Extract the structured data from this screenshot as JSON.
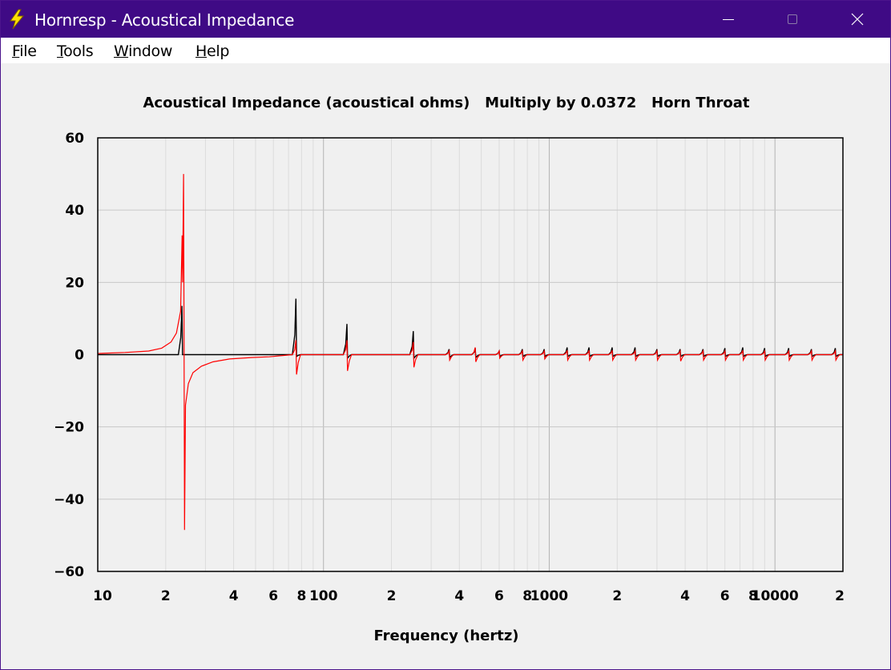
{
  "window": {
    "title": "Hornresp - Acoustical Impedance",
    "controls": [
      "minimize",
      "maximize",
      "close"
    ],
    "icon": "lightning-bolt-icon"
  },
  "menu": [
    {
      "label": "File",
      "accel": "F"
    },
    {
      "label": "Tools",
      "accel": "T"
    },
    {
      "label": "Window",
      "accel": "W"
    },
    {
      "label": "Help",
      "accel": "H"
    }
  ],
  "colors": {
    "titlebar": "#3f0a85",
    "series_black": "#000000",
    "series_red": "#ff0000",
    "grid": "#c8c8c8"
  },
  "chart_data": {
    "type": "line",
    "title": "Acoustical Impedance (acoustical ohms)   Multiply by 0.0372   Horn Throat",
    "xlabel": "Frequency (hertz)",
    "ylabel": "",
    "x_scale": "log",
    "xlim": [
      10,
      20000
    ],
    "ylim": [
      -60,
      60
    ],
    "yticks": [
      60,
      40,
      20,
      0,
      -20,
      -40,
      -60
    ],
    "ytick_labels": [
      "60",
      "40",
      "20",
      "0",
      "−20",
      "−40",
      "−60"
    ],
    "xticks": [
      {
        "value": 10,
        "label": "10"
      },
      {
        "value": 20,
        "label": "2"
      },
      {
        "value": 40,
        "label": "4"
      },
      {
        "value": 60,
        "label": "6"
      },
      {
        "value": 80,
        "label": "8"
      },
      {
        "value": 100,
        "label": "100"
      },
      {
        "value": 200,
        "label": "2"
      },
      {
        "value": 400,
        "label": "4"
      },
      {
        "value": 600,
        "label": "6"
      },
      {
        "value": 800,
        "label": "8"
      },
      {
        "value": 1000,
        "label": "1000"
      },
      {
        "value": 2000,
        "label": "2"
      },
      {
        "value": 4000,
        "label": "4"
      },
      {
        "value": 6000,
        "label": "6"
      },
      {
        "value": 8000,
        "label": "8"
      },
      {
        "value": 10000,
        "label": "10000"
      },
      {
        "value": 20000,
        "label": "2"
      }
    ],
    "grid": true,
    "series": [
      {
        "color": "#000000",
        "resonances": [
          {
            "f": 23.6,
            "pos": 13.5,
            "neg": 0
          },
          {
            "f": 75.5,
            "pos": 15.5,
            "neg": -0.5
          },
          {
            "f": 127,
            "pos": 8.5,
            "neg": -1
          },
          {
            "f": 250,
            "pos": 6.5,
            "neg": -1
          },
          {
            "f": 360,
            "pos": 1.5,
            "neg": -0.8
          },
          {
            "f": 470,
            "pos": 1.8,
            "neg": -0.8
          },
          {
            "f": 600,
            "pos": 1.0,
            "neg": -0.5
          },
          {
            "f": 760,
            "pos": 1.5,
            "neg": -0.5
          },
          {
            "f": 950,
            "pos": 1.5,
            "neg": -0.5
          },
          {
            "f": 1200,
            "pos": 2.0,
            "neg": -0.5
          },
          {
            "f": 1500,
            "pos": 2.0,
            "neg": -0.5
          },
          {
            "f": 1900,
            "pos": 2.0,
            "neg": -0.5
          },
          {
            "f": 2400,
            "pos": 2.0,
            "neg": -0.5
          },
          {
            "f": 3000,
            "pos": 1.5,
            "neg": -0.5
          },
          {
            "f": 3800,
            "pos": 1.5,
            "neg": -0.5
          },
          {
            "f": 4800,
            "pos": 1.5,
            "neg": -0.5
          },
          {
            "f": 6000,
            "pos": 1.8,
            "neg": -0.5
          },
          {
            "f": 7200,
            "pos": 2.0,
            "neg": -0.5
          },
          {
            "f": 9000,
            "pos": 1.8,
            "neg": -0.5
          },
          {
            "f": 11500,
            "pos": 1.8,
            "neg": -0.5
          },
          {
            "f": 14500,
            "pos": 1.5,
            "neg": -0.5
          },
          {
            "f": 18500,
            "pos": 1.8,
            "neg": -0.5
          }
        ]
      },
      {
        "color": "#ff0000",
        "resonances": [
          {
            "f": 24,
            "pos": 50,
            "neg": -48.5
          },
          {
            "f": 75.5,
            "pos": 4,
            "neg": -5.5
          },
          {
            "f": 127,
            "pos": 4,
            "neg": -4.5
          },
          {
            "f": 250,
            "pos": 3.5,
            "neg": -3.5
          },
          {
            "f": 360,
            "pos": 1.0,
            "neg": -1.5
          },
          {
            "f": 470,
            "pos": 2.0,
            "neg": -2.0
          },
          {
            "f": 600,
            "pos": 1.0,
            "neg": -1.0
          },
          {
            "f": 760,
            "pos": 1.0,
            "neg": -1.5
          },
          {
            "f": 950,
            "pos": 1.0,
            "neg": -1.2
          },
          {
            "f": 1200,
            "pos": 1.2,
            "neg": -1.5
          },
          {
            "f": 1500,
            "pos": 1.2,
            "neg": -1.5
          },
          {
            "f": 1900,
            "pos": 1.2,
            "neg": -1.5
          },
          {
            "f": 2400,
            "pos": 1.0,
            "neg": -1.5
          },
          {
            "f": 3000,
            "pos": 1.0,
            "neg": -1.5
          },
          {
            "f": 3800,
            "pos": 1.0,
            "neg": -1.8
          },
          {
            "f": 4800,
            "pos": 1.0,
            "neg": -1.5
          },
          {
            "f": 6000,
            "pos": 1.0,
            "neg": -1.5
          },
          {
            "f": 7200,
            "pos": 1.2,
            "neg": -1.5
          },
          {
            "f": 9000,
            "pos": 1.0,
            "neg": -1.5
          },
          {
            "f": 11500,
            "pos": 1.0,
            "neg": -1.5
          },
          {
            "f": 14500,
            "pos": 1.0,
            "neg": -1.5
          },
          {
            "f": 18500,
            "pos": 1.0,
            "neg": -1.5
          }
        ]
      }
    ]
  }
}
